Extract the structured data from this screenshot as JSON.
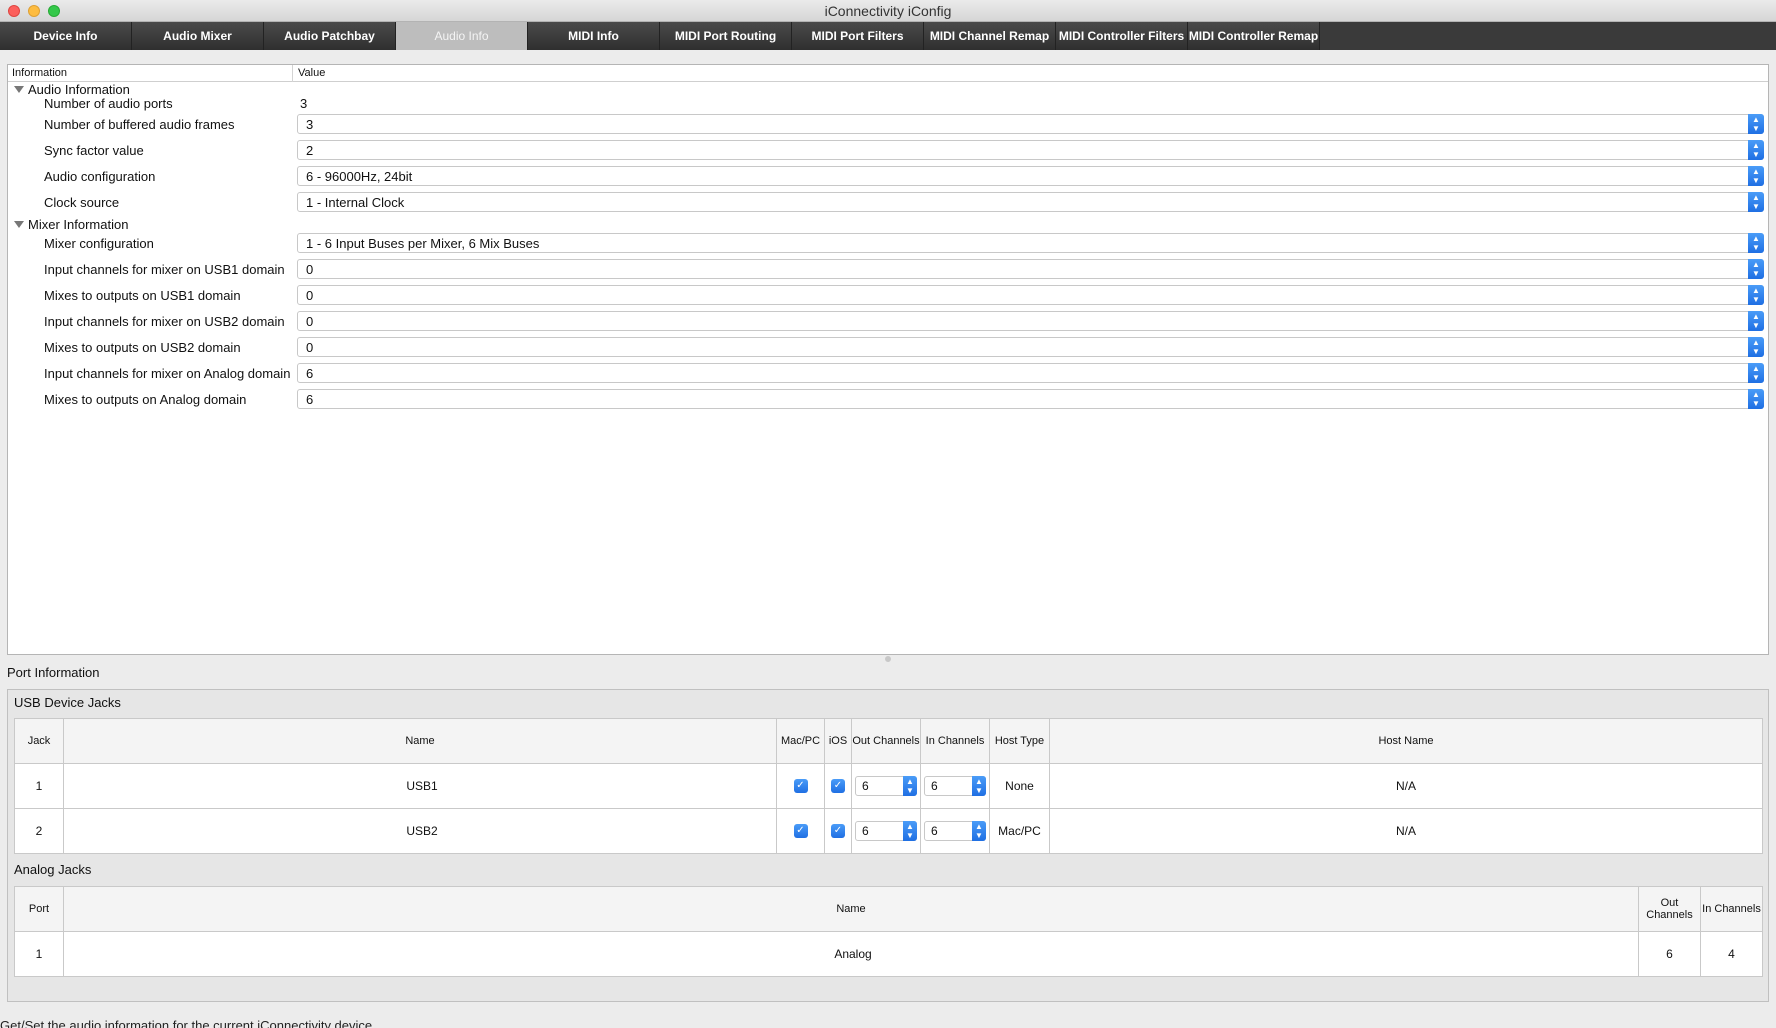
{
  "window": {
    "title": "iConnectivity iConfig"
  },
  "tabs": [
    {
      "label": "Device Info"
    },
    {
      "label": "Audio Mixer"
    },
    {
      "label": "Audio Patchbay"
    },
    {
      "label": "Audio Info"
    },
    {
      "label": "MIDI Info"
    },
    {
      "label": "MIDI Port Routing"
    },
    {
      "label": "MIDI Port Filters"
    },
    {
      "label": "MIDI Channel Remap"
    },
    {
      "label": "MIDI Controller Filters"
    },
    {
      "label": "MIDI Controller Remap"
    }
  ],
  "active_tab": "Audio Info",
  "tree": {
    "headers": {
      "information": "Information",
      "value": "Value"
    },
    "audio_group": {
      "label": "Audio Information",
      "rows": [
        {
          "label": "Number of audio ports",
          "value": "3"
        },
        {
          "label": "Number of buffered audio frames",
          "value": "3"
        },
        {
          "label": "Sync factor value",
          "value": "2"
        },
        {
          "label": "Audio configuration",
          "value": "6 - 96000Hz, 24bit"
        },
        {
          "label": "Clock source",
          "value": "1 - Internal Clock"
        }
      ]
    },
    "mixer_group": {
      "label": "Mixer Information",
      "rows": [
        {
          "label": "Mixer configuration",
          "value": "1 - 6 Input Buses per Mixer, 6 Mix Buses"
        },
        {
          "label": "Input channels for mixer on USB1 domain",
          "value": "0"
        },
        {
          "label": "Mixes to outputs on USB1 domain",
          "value": "0"
        },
        {
          "label": "Input channels for mixer on USB2 domain",
          "value": "0"
        },
        {
          "label": "Mixes to outputs on USB2 domain",
          "value": "0"
        },
        {
          "label": "Input channels for mixer on Analog domain",
          "value": "6"
        },
        {
          "label": "Mixes to outputs on Analog domain",
          "value": "6"
        }
      ]
    }
  },
  "port_info": {
    "title": "Port Information",
    "usb": {
      "label": "USB Device Jacks",
      "headers": {
        "jack": "Jack",
        "name": "Name",
        "macpc": "Mac/PC",
        "ios": "iOS",
        "out_channels": "Out Channels",
        "in_channels": "In Channels",
        "host_type": "Host Type",
        "host_name": "Host Name"
      },
      "rows": [
        {
          "jack": "1",
          "name": "USB1",
          "macpc": true,
          "ios": true,
          "out": "6",
          "in": "6",
          "host_type": "None",
          "host_name": "N/A"
        },
        {
          "jack": "2",
          "name": "USB2",
          "macpc": true,
          "ios": true,
          "out": "6",
          "in": "6",
          "host_type": "Mac/PC",
          "host_name": "N/A"
        }
      ]
    },
    "analog": {
      "label": "Analog Jacks",
      "headers": {
        "port": "Port",
        "name": "Name",
        "out_channels": "Out Channels",
        "in_channels": "In Channels"
      },
      "rows": [
        {
          "port": "1",
          "name": "Analog",
          "out": "6",
          "in": "4"
        }
      ]
    }
  },
  "status": "Get/Set the audio information for the current iConnectivity device",
  "colors": {
    "accent": "#1f6fe3",
    "tabbar": "#3a3a3a"
  }
}
